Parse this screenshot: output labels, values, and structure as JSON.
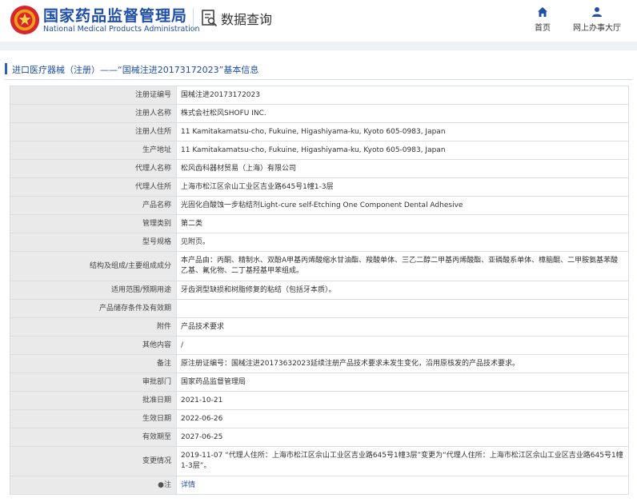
{
  "header": {
    "site_title_cn": "国家药品监督管理局",
    "site_title_en": "National Medical Products Administration",
    "search_title": "数据查询",
    "nav_home": "首页",
    "nav_service": "网上办事大厅"
  },
  "breadcrumb": {
    "text": "进口医疗器械（注册）——“国械注进20173172023”基本信息"
  },
  "rows": [
    {
      "label": "注册证编号",
      "value": "国械注进20173172023"
    },
    {
      "label": "注册人名称",
      "value": "株式会社松风SHOFU INC."
    },
    {
      "label": "注册人住所",
      "value": "11 Kamitakamatsu-cho, Fukuine, Higashiyama-ku, Kyoto 605-0983, Japan"
    },
    {
      "label": "生产地址",
      "value": "11 Kamitakamatsu-cho, Fukuine, Higashiyama-ku, Kyoto 605-0983, Japan"
    },
    {
      "label": "代理人名称",
      "value": "松风齿科器材贸易（上海）有限公司"
    },
    {
      "label": "代理人住所",
      "value": "上海市松江区佘山工业区吉业路645号1幢1-3层"
    },
    {
      "label": "产品名称",
      "value": "光固化自酸蚀一步粘结剂Light-cure self-Etching One Component Dental Adhesive"
    },
    {
      "label": "管理类别",
      "value": "第二类"
    },
    {
      "label": "型号规格",
      "value": "见附页。"
    },
    {
      "label": "结构及组成/主要组成成分",
      "value": "本产品由：丙酮、精制水、双酚A甲基丙烯酸缩水甘油酯、羧酸单体、三乙二醇二甲基丙烯酸酯、亚磷酸系单体、樟脑醌、二甲胺氨基苯酸乙基、氟化物、二丁基羟基甲苯组成。"
    },
    {
      "label": "适用范围/预期用途",
      "value": "牙齿洞型缺损和树脂修复的粘结（包括牙本质）。"
    },
    {
      "label": "产品储存条件及有效期",
      "value": ""
    },
    {
      "label": "附件",
      "value": "产品技术要求"
    },
    {
      "label": "其他内容",
      "value": "/"
    },
    {
      "label": "备注",
      "value": "原注册证编号：国械注进20173632023延续注册产品技术要求未发生变化，沿用原核发的产品技术要求。"
    },
    {
      "label": "审批部门",
      "value": "国家药品监督管理局"
    },
    {
      "label": "批准日期",
      "value": "2021-10-21"
    },
    {
      "label": "生效日期",
      "value": "2022-06-26"
    },
    {
      "label": "有效期至",
      "value": "2027-06-25"
    },
    {
      "label": "变更情况",
      "value": "2019-11-07 “代理人住所：上海市松江区佘山工业区吉业路645号1幢3层”变更为“代理人住所：上海市松江区佘山工业区吉业路645号1幢1-3层”。"
    }
  ],
  "note_row": {
    "bullet": "●注",
    "link": "详情"
  }
}
